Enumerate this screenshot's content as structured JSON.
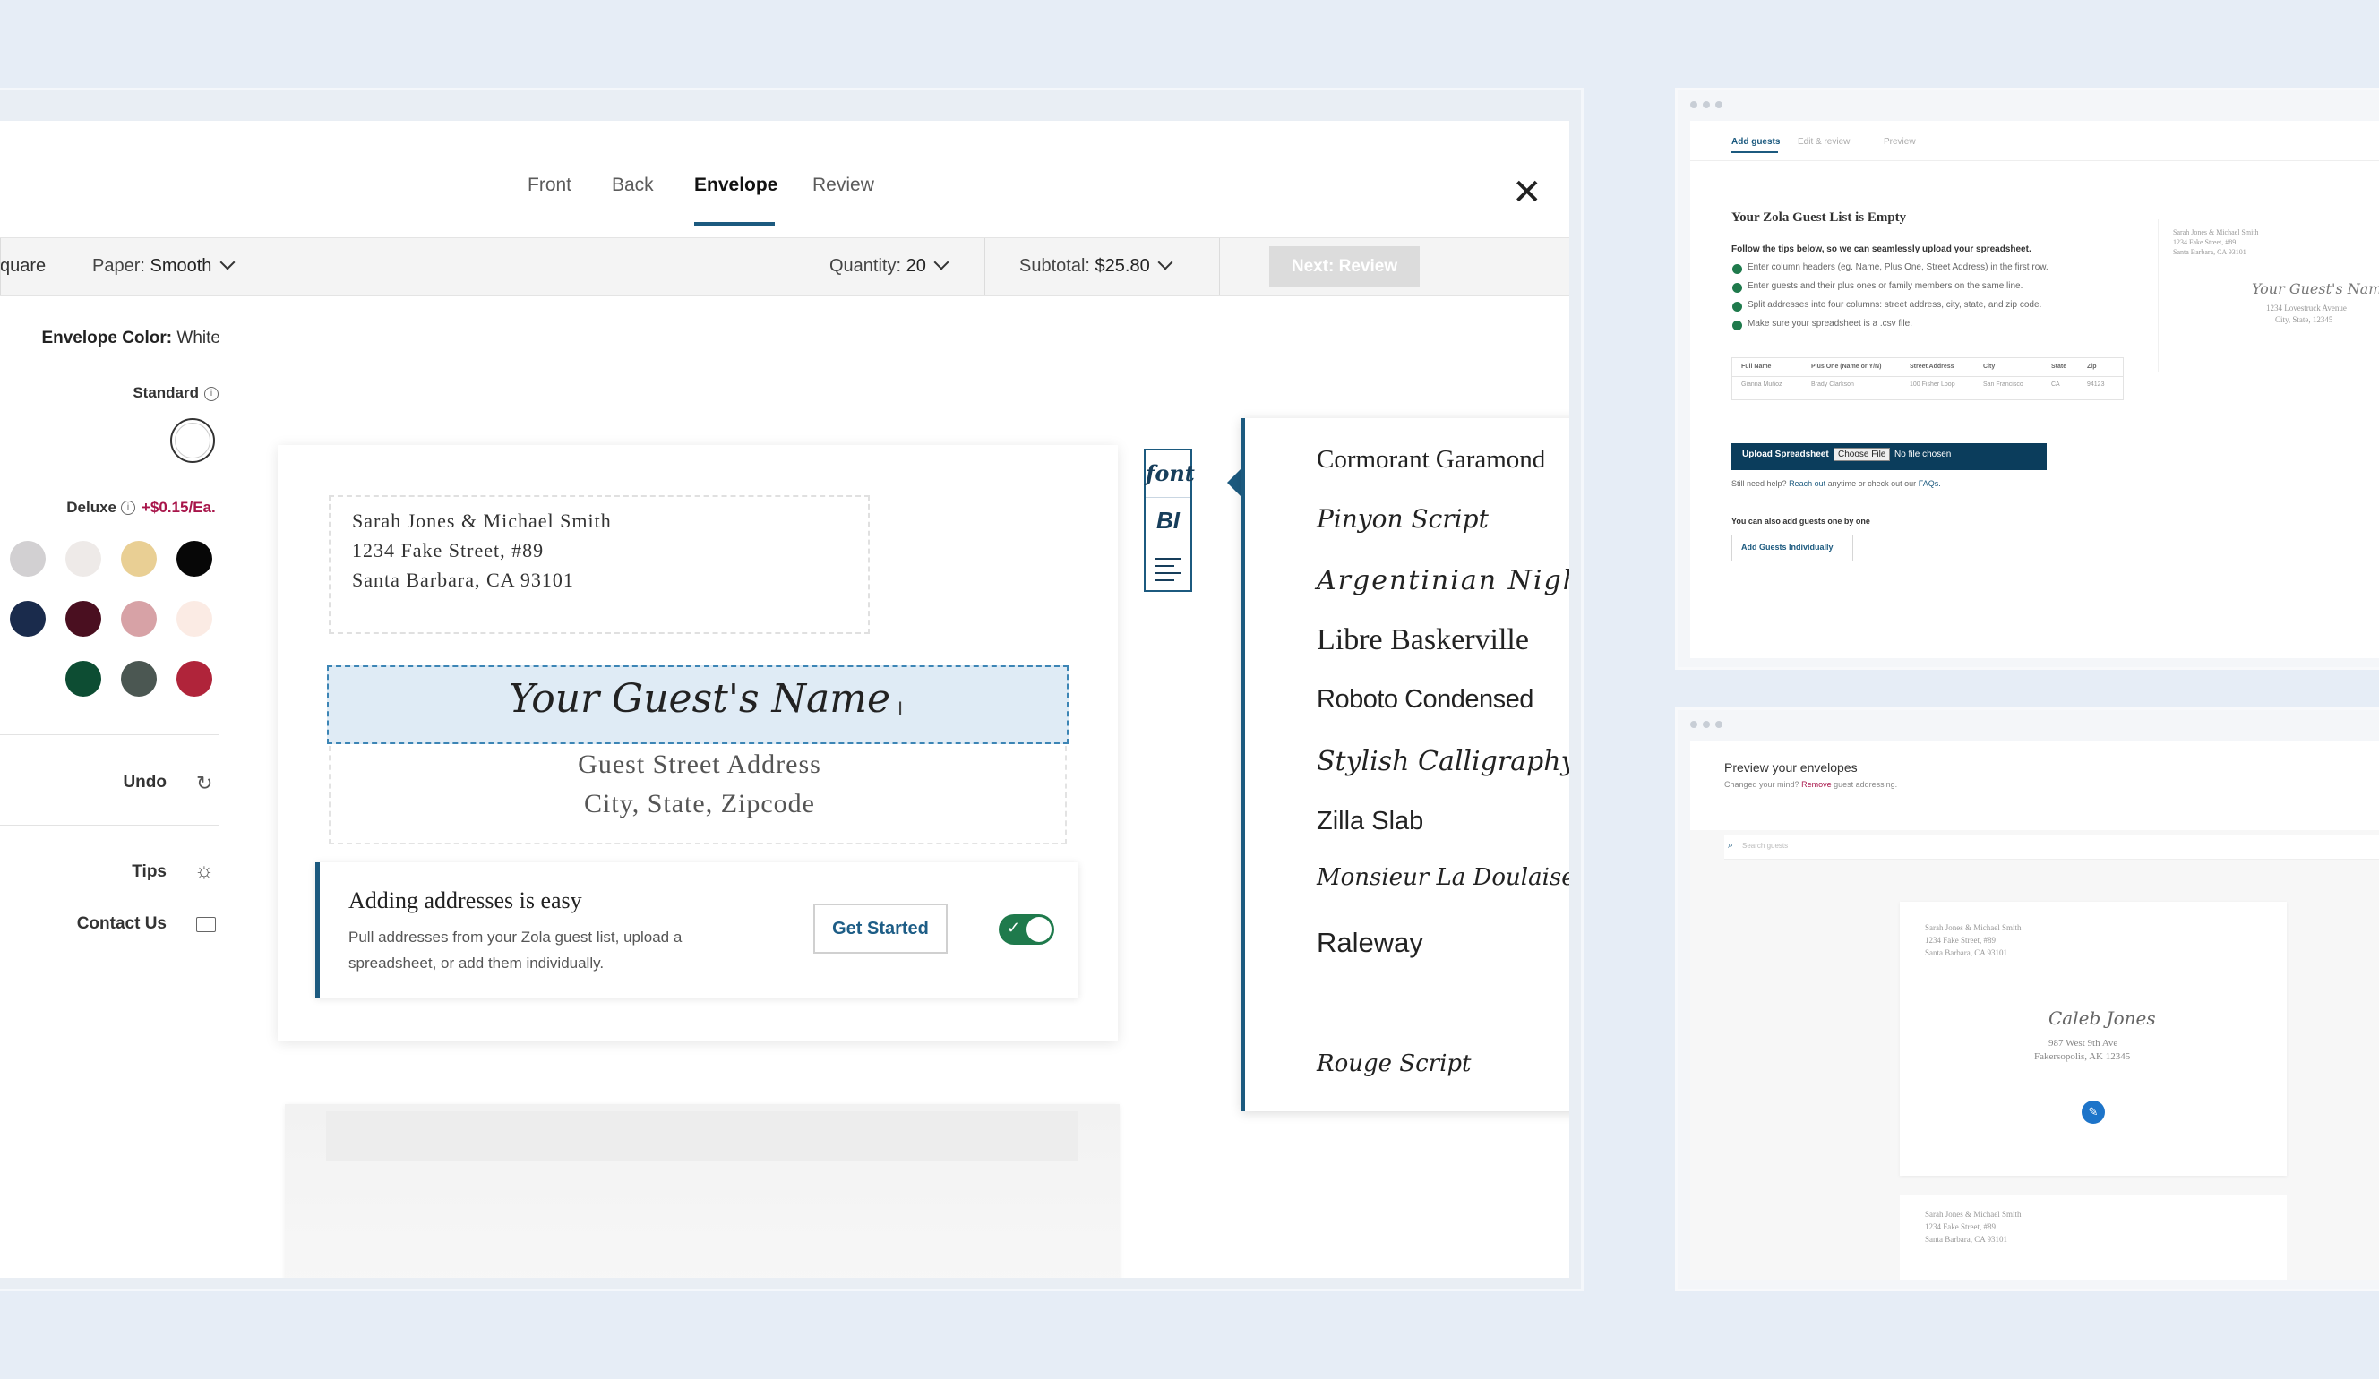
{
  "tabs": [
    {
      "label": "Front"
    },
    {
      "label": "Back"
    },
    {
      "label": "Envelope"
    },
    {
      "label": "Review"
    }
  ],
  "toolbar": {
    "shape_fragment": "quare",
    "paper_label": "Paper:",
    "paper_value": "Smooth",
    "quantity_label": "Quantity:",
    "quantity_value": "20",
    "subtotal_label": "Subtotal:",
    "subtotal_value": "$25.80",
    "next_label": "Next: Review"
  },
  "left_panel": {
    "envelope_color_label": "Envelope Color:",
    "envelope_color_value": "White",
    "standard_label": "Standard",
    "deluxe_label": "Deluxe",
    "deluxe_price": "+$0.15/Ea.",
    "undo_label": "Undo",
    "tips_label": "Tips",
    "contact_label": "Contact Us",
    "swatch_colors": [
      "#d2d0d2",
      "#eeeae8",
      "#e9cf94",
      "#070707",
      "#1a2b4c",
      "#4a0f20",
      "#d7a2a6",
      "#fbebe4",
      "#0d4d33",
      "#4b5752",
      "#b0243a"
    ]
  },
  "envelope": {
    "return_lines": [
      "Sarah Jones & Michael Smith",
      "1234 Fake Street, #89",
      "Santa Barbara, CA 93101"
    ],
    "guest_name": "Your Guest's Name",
    "guest_street": "Guest Street Address",
    "guest_city": "City, State, Zipcode"
  },
  "tip": {
    "title": "Adding addresses is easy",
    "body_line1": "Pull addresses from your Zola guest list, upload a",
    "body_line2": "spreadsheet, or add them individually.",
    "button": "Get Started"
  },
  "format_tools": {
    "font_icon": "font",
    "bold_italic": "BI"
  },
  "fonts": [
    "Cormorant Garamond",
    "Pinyon Script",
    "Argentinian Nights",
    "Libre Baskerville",
    "Roboto Condensed",
    "Stylish Calligraphy",
    "Zilla Slab",
    "Monsieur La Doulaise",
    "Raleway",
    "Rouge Script"
  ],
  "guest_list_window": {
    "steps": [
      "Add guests",
      "Edit & review",
      "Preview"
    ],
    "title": "Your Zola Guest List is Empty",
    "intro": "Follow the tips below, so we can seamlessly upload your spreadsheet.",
    "tips": [
      "Enter column headers (eg. Name, Plus One, Street Address) in the first row.",
      "Enter guests and their plus ones or family members on the same line.",
      "Split addresses into four columns: street address, city, state, and zip code.",
      "Make sure your spreadsheet is a .csv file."
    ],
    "table_headers": [
      "Full Name",
      "Plus One (Name or Y/N)",
      "Street Address",
      "City",
      "State",
      "Zip"
    ],
    "table_row": [
      "Gianna Muñoz",
      "Brady Clarkson",
      "100 Fisher Loop",
      "San Francisco",
      "CA",
      "94123"
    ],
    "upload_label": "Upload Spreadsheet",
    "choose_file": "Choose File",
    "no_file": "No file chosen",
    "help_prefix": "Still need help?",
    "help_link": "Reach out",
    "help_mid": "anytime or check out our",
    "help_faq": "FAQs.",
    "one_by_one": "You can also add guests one by one",
    "add_individually": "Add Guests Individually",
    "preview_return": [
      "Sarah Jones & Michael Smith",
      "1234 Fake Street, #89",
      "Santa Barbara, CA 93101"
    ],
    "preview_name": "Your Guest's Name",
    "preview_addr": [
      "1234 Lovestruck Avenue",
      "City, State, 12345"
    ]
  },
  "preview_window": {
    "title": "Preview your envelopes",
    "sub_prefix": "Changed your mind?",
    "sub_link": "Remove",
    "sub_suffix": "guest addressing.",
    "search_placeholder": "Search guests",
    "env1_return": [
      "Sarah Jones & Michael Smith",
      "1234 Fake Street, #89",
      "Santa Barbara, CA 93101"
    ],
    "env1_name": "Caleb Jones",
    "env1_addr": [
      "987 West 9th Ave",
      "Fakersopolis, AK 12345"
    ],
    "env2_return": [
      "Sarah Jones & Michael Smith",
      "1234 Fake Street, #89",
      "Santa Barbara, CA 93101"
    ]
  }
}
